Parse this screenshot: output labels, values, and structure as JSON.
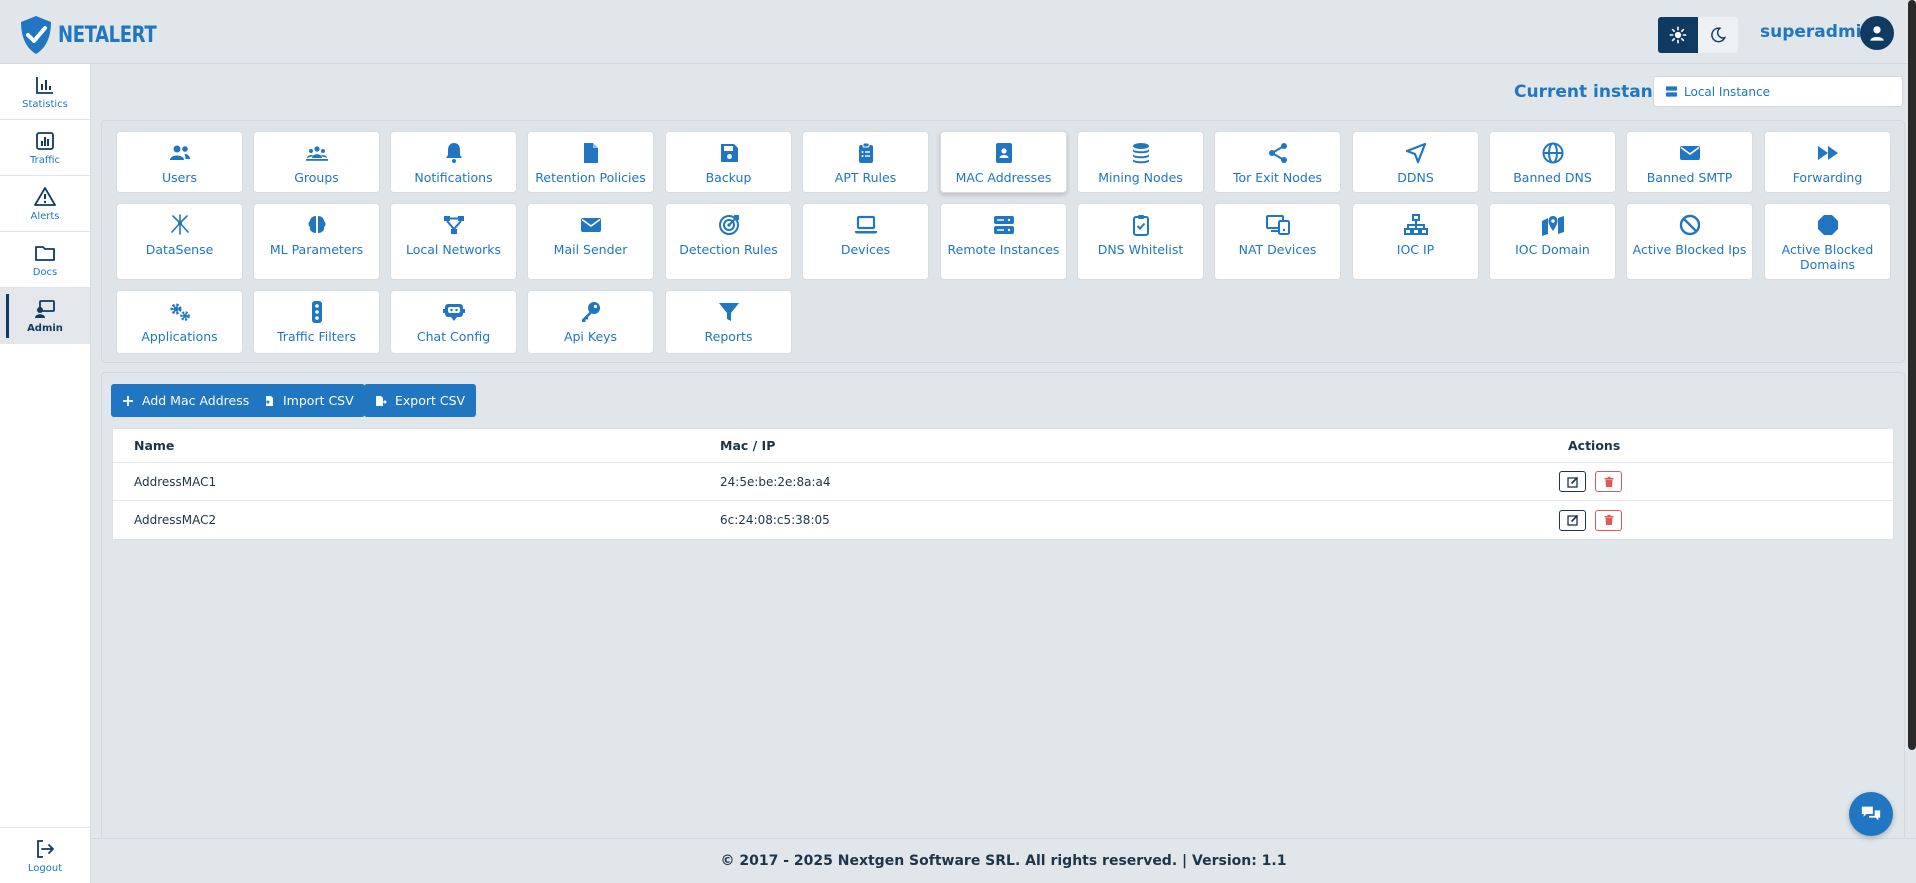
{
  "app": {
    "logo_text": "NETALERT",
    "user_name": "superadmin",
    "theme": {
      "light_icon": "sun-icon",
      "dark_icon": "moon-icon",
      "active": "light"
    }
  },
  "sidebar": {
    "items": [
      {
        "label": "Statistics",
        "icon": "chart-bar-icon"
      },
      {
        "label": "Traffic",
        "icon": "chart-line-icon"
      },
      {
        "label": "Alerts",
        "icon": "warning-icon"
      },
      {
        "label": "Docs",
        "icon": "folder-icon"
      },
      {
        "label": "Admin",
        "icon": "admin-icon"
      }
    ],
    "logout_label": "Logout"
  },
  "instance": {
    "label": "Current instance:",
    "value": "Local Instance"
  },
  "admin_tiles": [
    {
      "label": "Users",
      "icon": "users-icon"
    },
    {
      "label": "Groups",
      "icon": "groups-icon"
    },
    {
      "label": "Notifications",
      "icon": "bell-icon"
    },
    {
      "label": "Retention Policies",
      "icon": "file-icon"
    },
    {
      "label": "Backup",
      "icon": "floppy-icon"
    },
    {
      "label": "APT Rules",
      "icon": "clipboard-list-icon"
    },
    {
      "label": "MAC Addresses",
      "icon": "address-book-icon"
    },
    {
      "label": "Mining Nodes",
      "icon": "coins-icon"
    },
    {
      "label": "Tor Exit Nodes",
      "icon": "share-nodes-icon"
    },
    {
      "label": "DDNS",
      "icon": "location-arrow-icon"
    },
    {
      "label": "Banned DNS",
      "icon": "globe-icon"
    },
    {
      "label": "Banned SMTP",
      "icon": "envelope-icon"
    },
    {
      "label": "Forwarding",
      "icon": "forward-icon"
    },
    {
      "label": "DataSense",
      "icon": "sparkle-icon"
    },
    {
      "label": "ML Parameters",
      "icon": "brain-icon"
    },
    {
      "label": "Local Networks",
      "icon": "network-icon"
    },
    {
      "label": "Mail Sender",
      "icon": "envelope-icon"
    },
    {
      "label": "Detection Rules",
      "icon": "target-icon"
    },
    {
      "label": "Devices",
      "icon": "laptop-icon"
    },
    {
      "label": "Remote Instances",
      "icon": "server-icon"
    },
    {
      "label": "DNS Whitelist",
      "icon": "clipboard-check-icon"
    },
    {
      "label": "NAT Devices",
      "icon": "devices-icon"
    },
    {
      "label": "IOC IP",
      "icon": "sitemap-icon"
    },
    {
      "label": "IOC Domain",
      "icon": "map-marker-icon"
    },
    {
      "label": "Active Blocked Ips",
      "icon": "ban-icon"
    },
    {
      "label": "Active Blocked Domains",
      "icon": "octagon-icon"
    },
    {
      "label": "Applications",
      "icon": "gears-icon"
    },
    {
      "label": "Traffic Filters",
      "icon": "traffic-light-icon"
    },
    {
      "label": "Chat Config",
      "icon": "robot-chat-icon"
    },
    {
      "label": "Api Keys",
      "icon": "key-icon"
    },
    {
      "label": "Reports",
      "icon": "filter-icon"
    }
  ],
  "selected_tile": "MAC Addresses",
  "toolbar": {
    "add_label": "Add Mac Address",
    "import_label": "Import CSV",
    "export_label": "Export CSV"
  },
  "table": {
    "columns": [
      "Name",
      "Mac / IP",
      "Actions"
    ],
    "rows": [
      {
        "name": "AddressMAC1",
        "mac": "24:5e:be:2e:8a:a4"
      },
      {
        "name": "AddressMAC2",
        "mac": "6c:24:08:c5:38:05"
      }
    ]
  },
  "footer": {
    "text": "© 2017 - 2025 Nextgen Software SRL. All rights reserved. | Version: 1.1"
  },
  "colors": {
    "accent": "#2076c0",
    "dark": "#0f3b63",
    "background": "#e1e6ea",
    "danger": "#e05a5a"
  }
}
